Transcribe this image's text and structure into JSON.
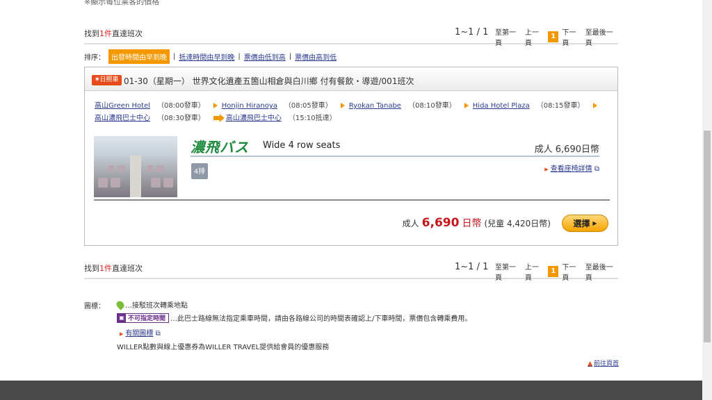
{
  "top_note": "※顯示每位乘客的價格",
  "results": {
    "found_prefix": "找到",
    "found_count": "1件",
    "found_suffix": "直達班次",
    "range": "1~1 / 1",
    "first": "至第一頁",
    "prev": "上一頁",
    "current": "1",
    "next": "下一頁",
    "last": "至最後一頁"
  },
  "sort": {
    "label": "排序：",
    "active": "出發時間由早到晚",
    "options": [
      "抵達時間由早到晚",
      "票價由低到高",
      "票價由高到低"
    ]
  },
  "trip": {
    "badge": "日照車",
    "title": "01-30（星期一） 世界文化遺產五箇山相倉與白川鄉 付有餐飲・導遊/001班次",
    "stops": [
      {
        "name": "高山Green Hotel",
        "time": "（08:00發車）"
      },
      {
        "name": "Honjin Hiranoya",
        "time": "（08:05發車）"
      },
      {
        "name": "Ryokan Tanabe",
        "time": "（08:10發車）"
      },
      {
        "name": "Hida Hotel Plaza",
        "time": "（08:15發車）"
      },
      {
        "name": "高山濃飛巴士中心",
        "time": "（08:30發車）"
      }
    ],
    "arrival": {
      "name": "高山濃飛巴士中心",
      "time": "（15:10抵達）"
    },
    "operator_logo": "濃飛バス",
    "seat_type": "Wide 4 row seats",
    "adult_price": "成人 6,690日幣",
    "seat_icon": "4排",
    "seat_link": "查看座椅詳情",
    "price_label": "成人",
    "price_value": "6,690",
    "price_currency": "日幣",
    "child_price": "(兒童 4,420日幣)",
    "select": "選擇"
  },
  "legend": {
    "label": "圖標：",
    "pin_text": "…接駁班次轉乘地點",
    "tag_text": "不可指定時間",
    "tag_desc": "…此巴士路線無法指定乘車時間，請由各路線公司的時間表確認上/下車時間，票價包含轉乘費用。",
    "detail_link": "有關圖標",
    "willer_note": "WILLER點數與線上優惠券為WILLER TRAVEL提供給會員的優惠服務",
    "back_top": "前往頁首"
  },
  "colors": {
    "accent": "#f39800",
    "price": "#c8161d",
    "link": "#2b3a8f",
    "footer": "#4a4a4a"
  }
}
